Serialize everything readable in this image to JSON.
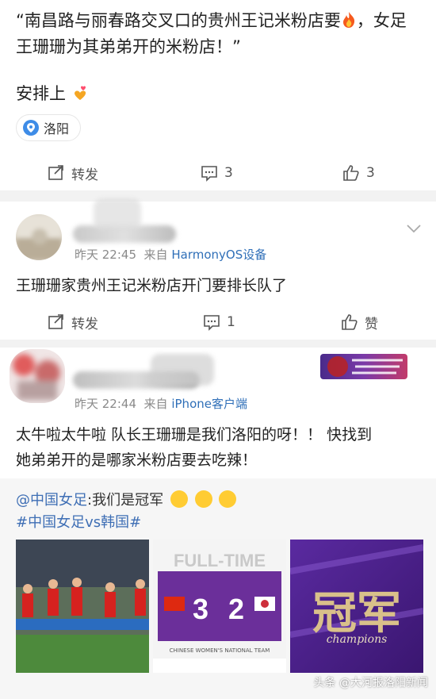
{
  "post": {
    "text_line": "“南昌路与丽春路交叉口的贵州王记米粉店要",
    "text_tail": "，女足王珊珊为其弟弟开的米粉店！”",
    "text2": "安排上",
    "location": "洛阳",
    "actions": {
      "repost_label": "转发",
      "comment_count": "3",
      "like_count": "3"
    }
  },
  "comments": [
    {
      "meta_time": "昨天 22:45",
      "meta_from": "来自",
      "meta_source": "HarmonyOS设备",
      "text": "王珊珊家贵州王记米粉店开门要排长队了",
      "actions": {
        "repost_label": "转发",
        "comment_count": "1",
        "like_label": "赞"
      }
    },
    {
      "meta_time": "昨天 22:44",
      "meta_from": "来自",
      "meta_source": "iPhone客户端",
      "text_line1": "太牛啦太牛啦 队长王珊珊是我们洛阳的呀！！ 快找到",
      "text_line2": "她弟弟开的是哪家米粉店要去吃辣！"
    }
  ],
  "repost": {
    "at_user": "@中国女足",
    "text": ":我们是冠军",
    "hashtag": "#中国女足vs韩国#",
    "thumbs": [
      {
        "kind": "photo"
      },
      {
        "kind": "scoreboard",
        "title": "FULL-TIME",
        "score_left": "3",
        "score_right": "2",
        "footer": "CHINESE WOMEN'S NATIONAL TEAM"
      },
      {
        "kind": "poster",
        "title": "冠军",
        "subtitle": "champions"
      }
    ]
  },
  "watermark": "头条 @大河报洛阳新闻",
  "colors": {
    "link": "#3f6fb5",
    "meta": "#8a8a8a",
    "location_blue": "#3e8ce7"
  }
}
